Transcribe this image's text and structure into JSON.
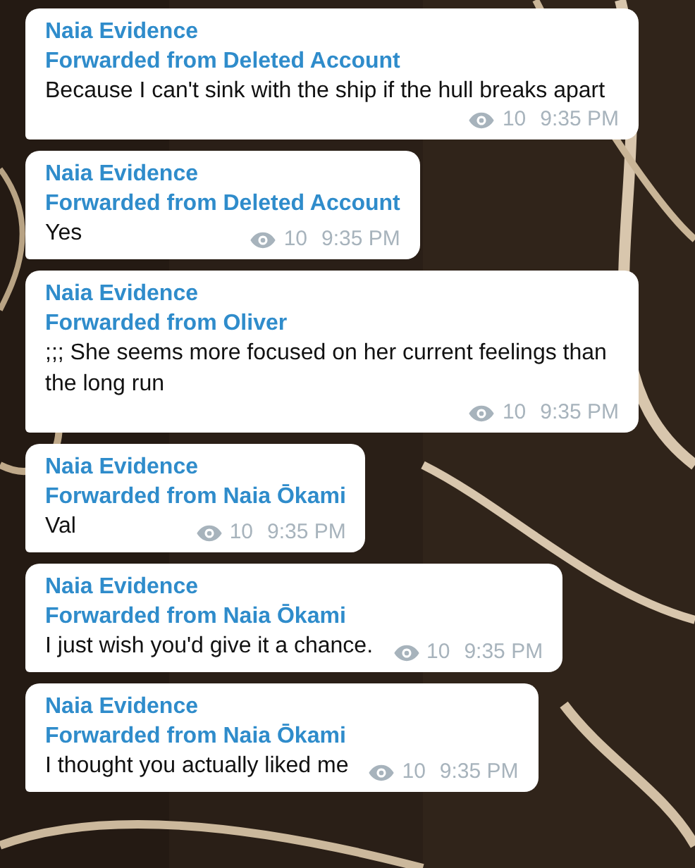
{
  "messages": [
    {
      "sender": "Naia Evidence",
      "forwarded_from": "Forwarded from Deleted Account",
      "text": "Because I can't sink with the ship if the hull breaks apart",
      "views": "10",
      "time": "9:35 PM"
    },
    {
      "sender": "Naia Evidence",
      "forwarded_from": "Forwarded from Deleted Account",
      "text": "Yes",
      "views": "10",
      "time": "9:35 PM"
    },
    {
      "sender": "Naia Evidence",
      "forwarded_from": "Forwarded from Oliver",
      "text": ";;; She seems more focused on her current feelings than the long run",
      "views": "10",
      "time": "9:35 PM"
    },
    {
      "sender": "Naia Evidence",
      "forwarded_from": "Forwarded from Naia Ōkami",
      "text": "Val",
      "views": "10",
      "time": "9:35 PM"
    },
    {
      "sender": "Naia Evidence",
      "forwarded_from": "Forwarded from Naia Ōkami",
      "text": "I just wish you'd give it a chance.",
      "views": "10",
      "time": "9:35 PM"
    },
    {
      "sender": "Naia Evidence",
      "forwarded_from": "Forwarded from Naia Ōkami",
      "text": "I thought you actually liked me",
      "views": "10",
      "time": "9:35 PM"
    }
  ]
}
